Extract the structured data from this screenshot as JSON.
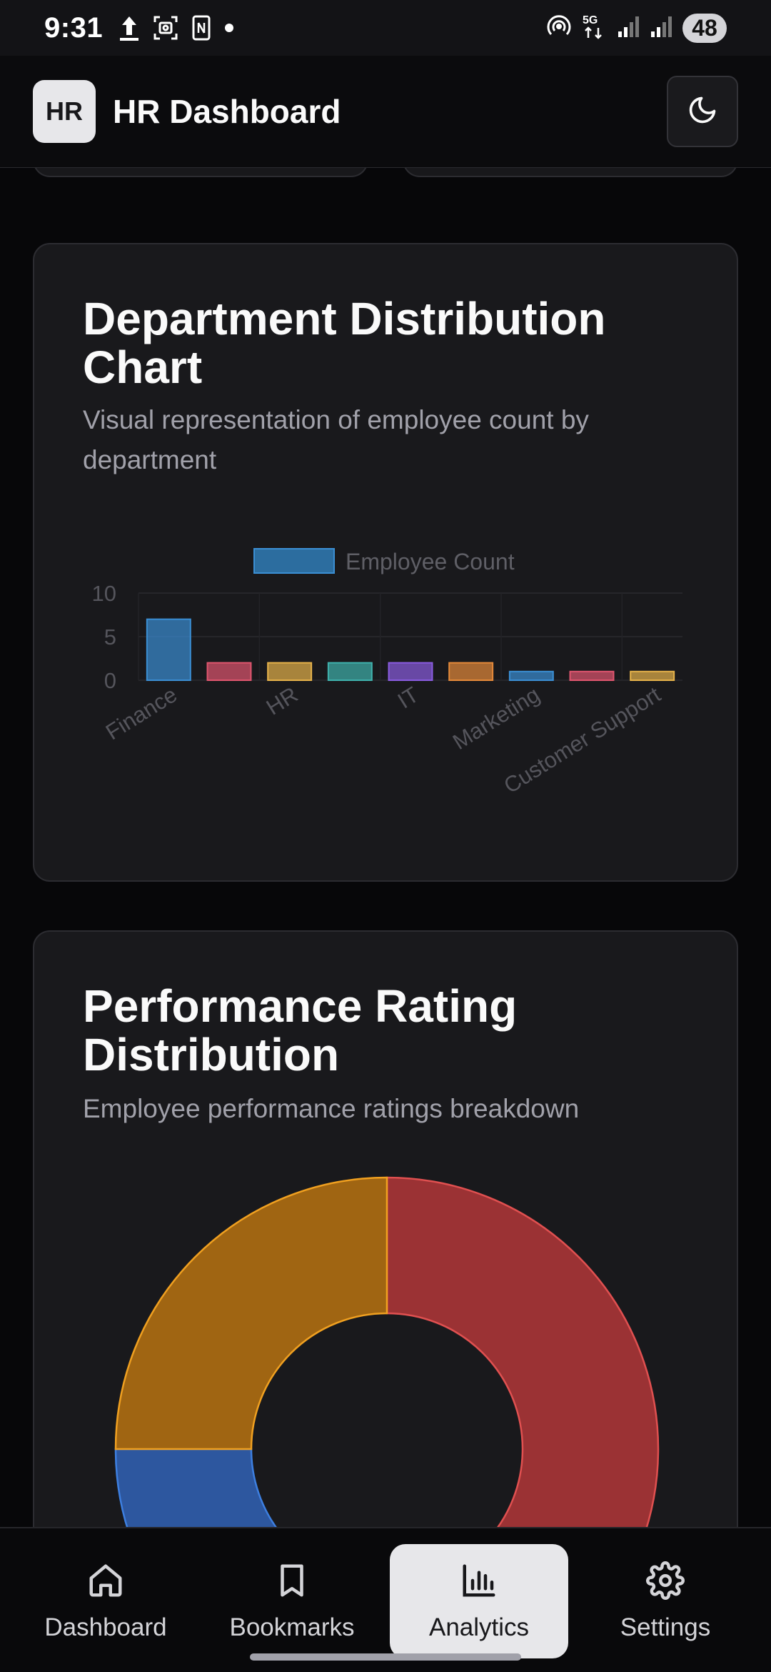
{
  "status_bar": {
    "time": "9:31",
    "left_icons": [
      "upload-icon",
      "screenshot-icon",
      "nfc-card-icon",
      "dot-icon"
    ],
    "right_icons": [
      "hotspot-icon",
      "5g-icon",
      "signal-icon",
      "signal-icon"
    ],
    "battery": "48"
  },
  "header": {
    "logo": "HR",
    "title": "HR Dashboard",
    "theme_toggle_icon": "moon-icon"
  },
  "department_card": {
    "title": "Department Distribution Chart",
    "description": "Visual representation of employee count by department"
  },
  "performance_card": {
    "title": "Performance Rating Distribution",
    "description": "Employee performance ratings breakdown"
  },
  "chart_data": [
    {
      "type": "bar",
      "legend": [
        "Employee Count"
      ],
      "legend_position": "top",
      "categories": [
        "Finance",
        "",
        "HR",
        "",
        "IT",
        "",
        "Marketing",
        "",
        "Customer Support"
      ],
      "x_tick_labels": [
        "Finance",
        "HR",
        "IT",
        "Marketing",
        "Customer Support"
      ],
      "series": [
        {
          "name": "Employee Count",
          "values": [
            7,
            2,
            2,
            2,
            2,
            2,
            1,
            1,
            1
          ]
        }
      ],
      "bar_colors": [
        "#3b8fd4",
        "#e0566f",
        "#e6b24a",
        "#3fb2ad",
        "#8a5ce0",
        "#e58a3a",
        "#3b8fd4",
        "#e0566f",
        "#e6b24a"
      ],
      "yticks": [
        0,
        5,
        10
      ],
      "ylim": [
        0,
        10
      ],
      "grid": true
    },
    {
      "type": "pie",
      "variant": "donut",
      "series": [
        {
          "values": [
            50,
            25,
            25
          ],
          "colors": [
            "#9b3234",
            "#2d579f",
            "#a06512"
          ]
        }
      ]
    }
  ],
  "bottom_nav": [
    {
      "label": "Dashboard",
      "icon": "home-icon",
      "active": false
    },
    {
      "label": "Bookmarks",
      "icon": "bookmark-icon",
      "active": false
    },
    {
      "label": "Analytics",
      "icon": "bar-chart-icon",
      "active": true
    },
    {
      "label": "Settings",
      "icon": "gear-icon",
      "active": false
    }
  ]
}
